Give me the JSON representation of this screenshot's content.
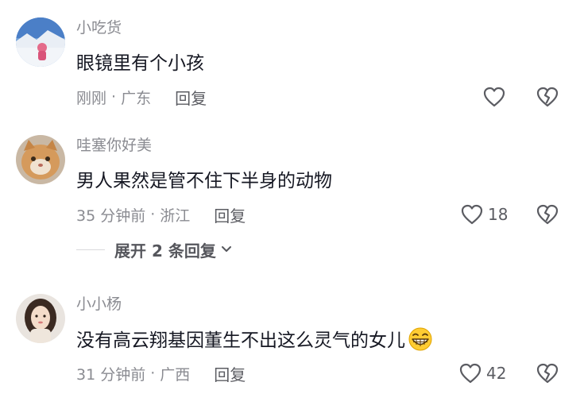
{
  "comments": [
    {
      "username": "小吃货",
      "text": "眼镜里有个小孩",
      "time": "刚刚",
      "location": "广东",
      "reply_label": "回复",
      "likes": ""
    },
    {
      "username": "哇塞你好美",
      "text": "男人果然是管不住下半身的动物",
      "time": "35 分钟前",
      "location": "浙江",
      "reply_label": "回复",
      "likes": "18"
    },
    {
      "username": "小小杨",
      "text": "没有高云翔基因董生不出这么灵气的女儿",
      "time": "31 分钟前",
      "location": "广西",
      "reply_label": "回复",
      "likes": "42"
    }
  ],
  "expand_replies": "展开 2 条回复",
  "separator": "·",
  "icons": {
    "like": "heart-outline-icon",
    "dislike": "broken-heart-icon",
    "emoji": "grinning-emoji-icon",
    "expand": "chevron-down-icon"
  },
  "colors": {
    "text": "#161823",
    "muted": "#8a8b91",
    "icon": "#5b5c62"
  }
}
